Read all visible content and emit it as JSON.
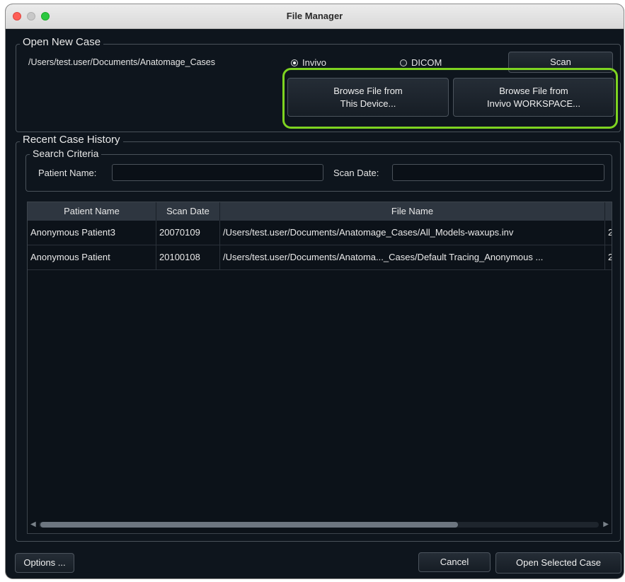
{
  "window": {
    "title": "File Manager"
  },
  "open_new_case": {
    "legend": "Open New Case",
    "path": "/Users/test.user/Documents/Anatomage_Cases",
    "radio_invivo": "Invivo",
    "radio_dicom": "DICOM",
    "selected": "Invivo",
    "scan_button": "Scan",
    "browse_device_line1": "Browse File from",
    "browse_device_line2": "This Device...",
    "browse_workspace_line1": "Browse File from",
    "browse_workspace_line2": "Invivo WORKSPACE...",
    "highlight_color": "#7ed321"
  },
  "recent": {
    "legend": "Recent Case History",
    "search_legend": "Search Criteria",
    "patient_name_label": "Patient Name:",
    "patient_name_value": "",
    "scan_date_label": "Scan Date:",
    "scan_date_value": ""
  },
  "table": {
    "columns": [
      "Patient Name",
      "Scan Date",
      "File Name"
    ],
    "rows": [
      {
        "patient": "Anonymous Patient3",
        "date": "20070109",
        "file": "/Users/test.user/Documents/Anatomage_Cases/All_Models-waxups.inv",
        "extra": "2"
      },
      {
        "patient": "Anonymous Patient",
        "date": "20100108",
        "file": "/Users/test.user/Documents/Anatoma..._Cases/Default Tracing_Anonymous ...",
        "extra": "2"
      }
    ]
  },
  "footer": {
    "options_button": "Options ...",
    "cancel_button": "Cancel",
    "open_button": "Open Selected Case"
  },
  "icons": [
    "close-window-icon",
    "minimize-window-icon",
    "maximize-window-icon",
    "scroll-left-arrow-icon",
    "scroll-right-arrow-icon"
  ]
}
